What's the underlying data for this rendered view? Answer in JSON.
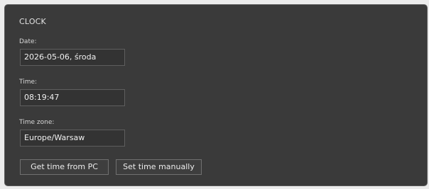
{
  "clock": {
    "title": "CLOCK",
    "date": {
      "label": "Date:",
      "value": "2026-05-06, środa"
    },
    "time": {
      "label": "Time:",
      "value": "08:19:47"
    },
    "timezone": {
      "label": "Time zone:",
      "value": "Europe/Warsaw"
    },
    "buttons": {
      "from_pc": "Get time from PC",
      "manual": "Set time manually"
    }
  }
}
